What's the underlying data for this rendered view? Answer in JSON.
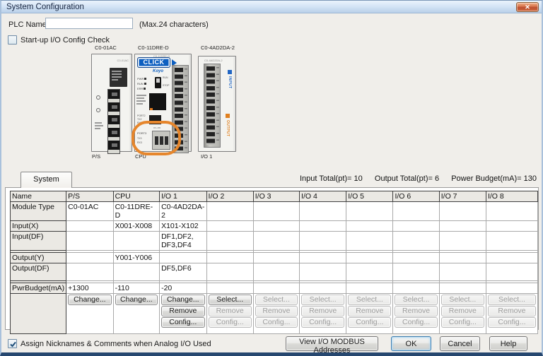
{
  "window": {
    "title": "System Configuration",
    "close_glyph": "✕"
  },
  "header": {
    "plc_name_label": "PLC Name",
    "plc_name_value": "",
    "plc_name_hint": "(Max.24 characters)",
    "startup_check_label": "Start-up I/O Config Check",
    "startup_check_checked": false
  },
  "plc_graphic": {
    "top_labels": [
      "C0-01AC",
      "C0-11DRE-D",
      "C0-4AD2DA-2"
    ],
    "bottom_labels": [
      "P/S",
      "CPU",
      "I/O 1"
    ],
    "ps": {
      "model": "C0-01AC"
    },
    "cpu": {
      "logo": "CLICK",
      "logo_sub": "Koyo",
      "model": "C0-11DRE-D",
      "led_labels": [
        "PWR",
        "RUN",
        "ERR"
      ],
      "switch_labels": [
        "RUN",
        "STOP"
      ],
      "port2": {
        "label": "PORT2",
        "tx": "TX2",
        "rx": "RX2"
      },
      "port3": {
        "label": "PORT3",
        "tx": "TX3",
        "rx": "RX3",
        "sub": "RS-485"
      }
    },
    "io": {
      "model": "C0-4AD2DA-2",
      "input_label": "INPUT",
      "output_label": "OUTPUT"
    }
  },
  "tab": {
    "label": "System"
  },
  "totals": {
    "input": "Input Total(pt)= 10",
    "output": "Output Total(pt)= 6",
    "power": "Power Budget(mA)= 130"
  },
  "table": {
    "columns": [
      "Name",
      "P/S",
      "CPU",
      "I/O 1",
      "I/O 2",
      "I/O 3",
      "I/O 4",
      "I/O 5",
      "I/O 6",
      "I/O 7",
      "I/O 8"
    ],
    "rows": [
      {
        "name": "Module Type",
        "values": [
          "C0-01AC",
          "C0-11DRE-D",
          "C0-4AD2DA-2",
          "",
          "",
          "",
          "",
          "",
          "",
          ""
        ]
      },
      {
        "name": "Input(X)",
        "values": [
          "",
          "X001-X008",
          "X101-X102",
          "",
          "",
          "",
          "",
          "",
          "",
          ""
        ]
      },
      {
        "name": "Input(DF)",
        "values": [
          "",
          "",
          "DF1,DF2,\nDF3,DF4",
          "",
          "",
          "",
          "",
          "",
          "",
          ""
        ]
      },
      {
        "name": "Output(Y)",
        "values": [
          "",
          "Y001-Y006",
          "",
          "",
          "",
          "",
          "",
          "",
          "",
          ""
        ]
      },
      {
        "name": "Output(DF)",
        "values": [
          "",
          "",
          "DF5,DF6",
          "",
          "",
          "",
          "",
          "",
          "",
          ""
        ]
      },
      {
        "name": "PwrBudget(mA)",
        "values": [
          "+1300",
          "-110",
          "-20",
          "",
          "",
          "",
          "",
          "",
          "",
          ""
        ]
      }
    ],
    "action_columns": [
      {
        "column": "P/S",
        "buttons": [
          {
            "label": "Change...",
            "enabled": true
          }
        ]
      },
      {
        "column": "CPU",
        "buttons": [
          {
            "label": "Change...",
            "enabled": true
          }
        ]
      },
      {
        "column": "I/O 1",
        "buttons": [
          {
            "label": "Change...",
            "enabled": true
          },
          {
            "label": "Remove",
            "enabled": true
          },
          {
            "label": "Config...",
            "enabled": true
          }
        ]
      },
      {
        "column": "I/O 2",
        "buttons": [
          {
            "label": "Select...",
            "enabled": true
          },
          {
            "label": "Remove",
            "enabled": false
          },
          {
            "label": "Config...",
            "enabled": false
          }
        ]
      },
      {
        "column": "I/O 3",
        "buttons": [
          {
            "label": "Select...",
            "enabled": false
          },
          {
            "label": "Remove",
            "enabled": false
          },
          {
            "label": "Config...",
            "enabled": false
          }
        ]
      },
      {
        "column": "I/O 4",
        "buttons": [
          {
            "label": "Select...",
            "enabled": false
          },
          {
            "label": "Remove",
            "enabled": false
          },
          {
            "label": "Config...",
            "enabled": false
          }
        ]
      },
      {
        "column": "I/O 5",
        "buttons": [
          {
            "label": "Select...",
            "enabled": false
          },
          {
            "label": "Remove",
            "enabled": false
          },
          {
            "label": "Config...",
            "enabled": false
          }
        ]
      },
      {
        "column": "I/O 6",
        "buttons": [
          {
            "label": "Select...",
            "enabled": false
          },
          {
            "label": "Remove",
            "enabled": false
          },
          {
            "label": "Config...",
            "enabled": false
          }
        ]
      },
      {
        "column": "I/O 7",
        "buttons": [
          {
            "label": "Select...",
            "enabled": false
          },
          {
            "label": "Remove",
            "enabled": false
          },
          {
            "label": "Config...",
            "enabled": false
          }
        ]
      },
      {
        "column": "I/O 8",
        "buttons": [
          {
            "label": "Select...",
            "enabled": false
          },
          {
            "label": "Remove",
            "enabled": false
          },
          {
            "label": "Config...",
            "enabled": false
          }
        ]
      }
    ]
  },
  "footer": {
    "assign_label": "Assign Nicknames & Comments when Analog I/O Used",
    "assign_checked": true,
    "view_modbus_label": "View I/O MODBUS Addresses",
    "ok_label": "OK",
    "cancel_label": "Cancel",
    "help_label": "Help"
  }
}
